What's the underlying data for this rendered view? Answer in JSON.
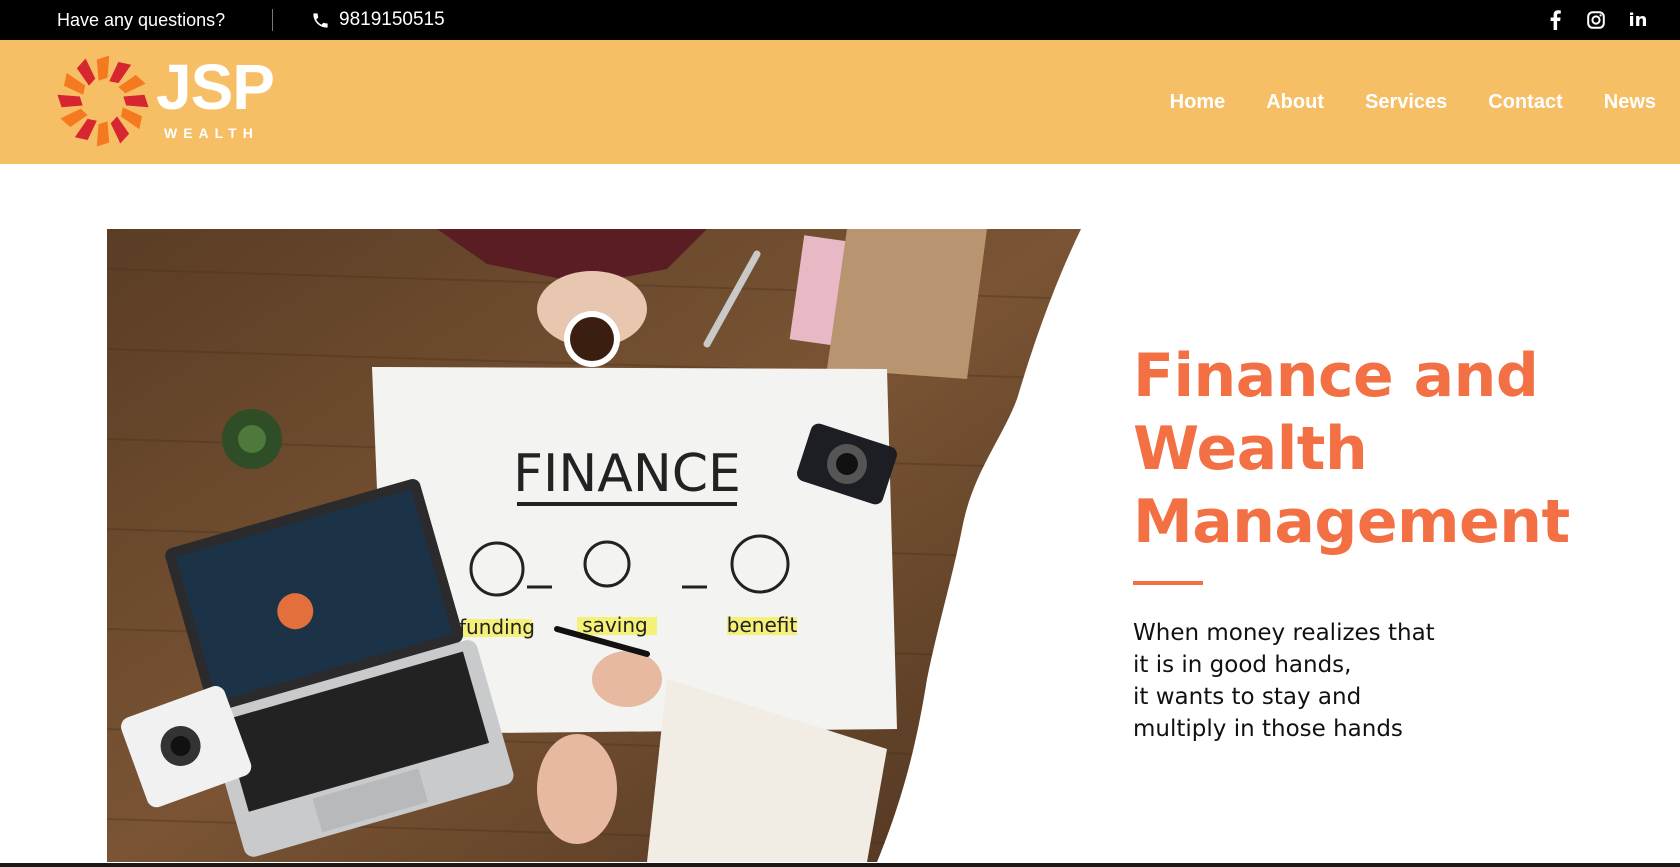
{
  "topbar": {
    "questions": "Have any questions?",
    "phone": "9819150515",
    "phone_icon": "phone-icon",
    "social": [
      {
        "name": "facebook-icon",
        "glyph": "f"
      },
      {
        "name": "instagram-icon"
      },
      {
        "name": "linkedin-icon",
        "glyph": "in"
      }
    ]
  },
  "header": {
    "logo": {
      "brand": "JSP",
      "sub": "WEALTH",
      "icon": "sunburst-logo-icon"
    },
    "nav": [
      "Home",
      "About",
      "Services",
      "Contact",
      "News"
    ]
  },
  "hero": {
    "title_lines": [
      "Finance and",
      "Wealth",
      "Management"
    ],
    "tagline_lines": [
      "When money realizes that",
      "it is in good hands,",
      "it wants to stay and",
      "multiply in those hands"
    ],
    "image": {
      "heading": "FINANCE",
      "labels": [
        "funding",
        "saving",
        "benefit"
      ]
    }
  },
  "colors": {
    "topbar_bg": "#000000",
    "header_bg": "#f6bf66",
    "accent": "#f27043",
    "logo_red": "#d6262f",
    "logo_orange": "#f57a1f"
  }
}
